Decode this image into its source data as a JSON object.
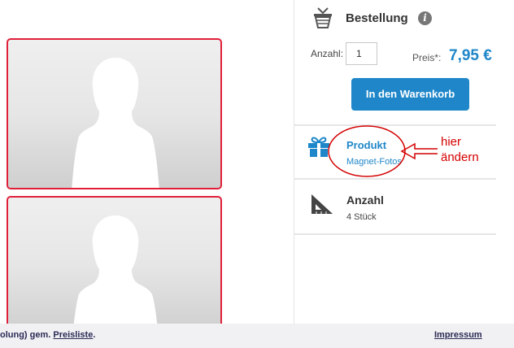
{
  "order": {
    "title": "Bestellung",
    "info_icon": "info-icon",
    "quantity_label": "Anzahl:",
    "quantity_value": "1",
    "price_label": "Preis*:",
    "price_value": "7,95 €",
    "cart_button_label": "In den Warenkorb"
  },
  "product": {
    "icon": "gift-icon",
    "title": "Produkt",
    "value": "Magnet-Fotos"
  },
  "amount": {
    "icon": "ruler-triangle-icon",
    "title": "Anzahl",
    "value": "4 Stück"
  },
  "annotation": {
    "line1": "hier",
    "line2": "ändern",
    "color": "#d40000"
  },
  "photos": {
    "placeholder_icon": "person-silhouette-icon",
    "frame_color": "#e0203a"
  },
  "footer": {
    "text_prefix": "olung) gem. ",
    "price_list_link": "Preisliste",
    "text_suffix": ".",
    "impressum_link": "Impressum"
  },
  "colors": {
    "accent": "#1f87c9"
  }
}
